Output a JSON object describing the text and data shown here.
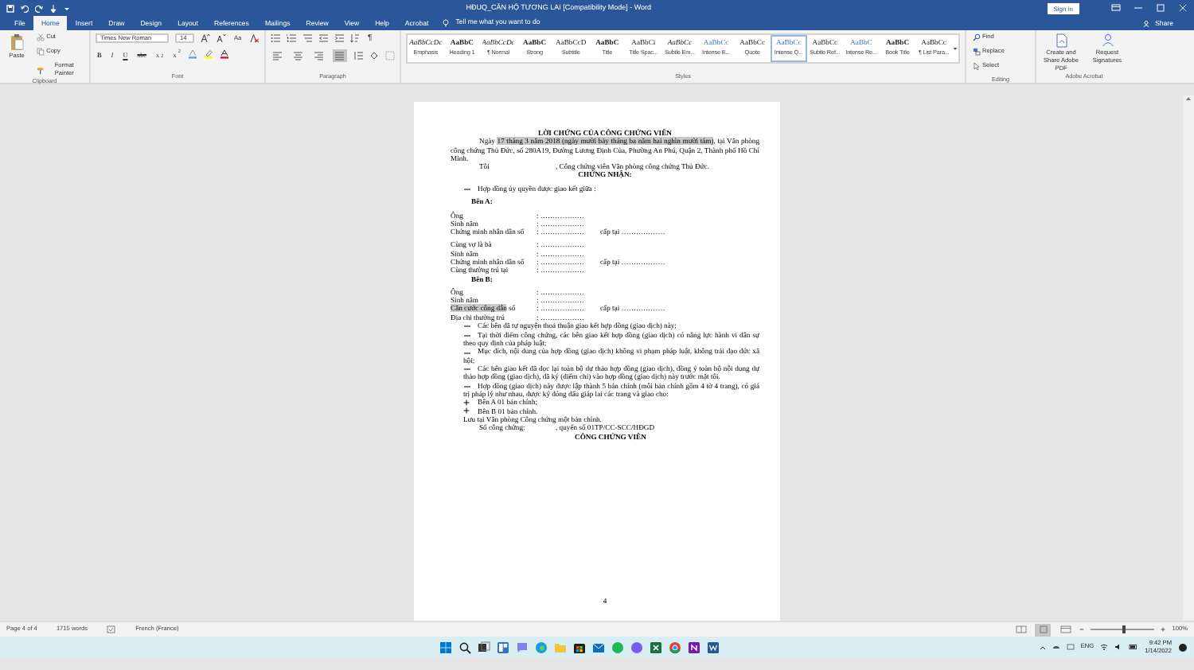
{
  "window": {
    "title": "HĐUQ_CĂN HỘ TƯƠNG LAI [Compatibility Mode] - Word",
    "sign_in": "Sign in"
  },
  "tabs": [
    {
      "label": "File",
      "selected": false
    },
    {
      "label": "Home",
      "selected": true
    },
    {
      "label": "Insert",
      "selected": false
    },
    {
      "label": "Draw",
      "selected": false
    },
    {
      "label": "Design",
      "selected": false
    },
    {
      "label": "Layout",
      "selected": false
    },
    {
      "label": "References",
      "selected": false
    },
    {
      "label": "Mailings",
      "selected": false
    },
    {
      "label": "Review",
      "selected": false
    },
    {
      "label": "View",
      "selected": false
    },
    {
      "label": "Help",
      "selected": false
    },
    {
      "label": "Acrobat",
      "selected": false
    }
  ],
  "tell_me": "Tell me what you want to do",
  "share": "Share",
  "clipboard": {
    "paste": "Paste",
    "cut": "Cut",
    "copy": "Copy",
    "format_painter": "Format Painter",
    "label": "Clipboard"
  },
  "font": {
    "name": "Times New Roman",
    "size": "14",
    "change_case": "Aa",
    "buttons": [
      "B",
      "I",
      "U",
      "abc",
      "x$_{2}$",
      "x$^{2}$"
    ],
    "label": "Font"
  },
  "paragraph": {
    "pilcrow": "¶",
    "alignments": [
      {
        "kind": "left",
        "selected": false
      },
      {
        "kind": "center",
        "selected": false
      },
      {
        "kind": "right",
        "selected": false
      },
      {
        "kind": "justify",
        "selected": true
      }
    ],
    "label": "Paragraph"
  },
  "styles": {
    "items": [
      {
        "sample": "AaBbCcDc",
        "name": "Emphasis",
        "kind": "italic",
        "selected": false
      },
      {
        "sample": "AaBbC",
        "name": "Heading 1",
        "kind": "bold",
        "selected": false
      },
      {
        "sample": "AaBbCcDc",
        "name": "¶ Normal",
        "kind": "italic",
        "selected": false
      },
      {
        "sample": "AaBbC",
        "name": "Strong",
        "kind": "bold",
        "selected": false
      },
      {
        "sample": "AaBbCcD",
        "name": "Subtitle",
        "kind": "plain",
        "selected": false
      },
      {
        "sample": "AaBbC",
        "name": "Title",
        "kind": "bold",
        "selected": false
      },
      {
        "sample": "AaBbCi",
        "name": "Title Spac...",
        "kind": "plain",
        "selected": false
      },
      {
        "sample": "AaBbCc",
        "name": "Subtle Em...",
        "kind": "italic",
        "selected": false
      },
      {
        "sample": "AaBbCc",
        "name": "Intense E...",
        "kind": "accent",
        "selected": false
      },
      {
        "sample": "AaBbCc",
        "name": "Quote",
        "kind": "plain",
        "selected": false
      },
      {
        "sample": "AaBbCc",
        "name": "Intense Q...",
        "kind": "accent",
        "selected": true
      },
      {
        "sample": "AaBbCc",
        "name": "Subtle Ref...",
        "kind": "plain",
        "selected": false
      },
      {
        "sample": "AaBbC",
        "name": "Intense Re...",
        "kind": "accent",
        "selected": false
      },
      {
        "sample": "AaBbC",
        "name": "Book Title",
        "kind": "bold",
        "selected": false
      },
      {
        "sample": "AaBbCc",
        "name": "¶ List Para...",
        "kind": "plain",
        "selected": false
      }
    ],
    "label": "Styles"
  },
  "editing": {
    "find": "Find",
    "replace": "Replace",
    "select": "Select",
    "label": "Editing"
  },
  "acrobat": {
    "create": "Create and Share Adobe PDF",
    "request": "Request Signatures",
    "label": "Adobe Acrobat"
  },
  "document": {
    "page_number": "4",
    "blocks": [
      {
        "kind": "title",
        "text": "LỜI CHỨNG CỦA CÔNG CHỨNG VIÊN"
      },
      {
        "kind": "para",
        "segments": [
          {
            "text": "Ngày ",
            "highlighted": false
          },
          {
            "text": "17 tháng 3 năm 2018 (ngày mười bảy tháng ba năm hai nghìn mười tám)",
            "highlighted": true
          },
          {
            "text": ", tại Văn phòng công chứng Thủ Đức, số 280A19, Đường Lương Định Của, Phường An Phú, Quận 2, Thành phố Hồ Chí Minh.",
            "highlighted": false
          }
        ]
      },
      {
        "kind": "fill",
        "before": "Tôi",
        "after": ", Công chứng viên Văn phòng công chứng Thủ Đức."
      },
      {
        "kind": "center",
        "text": "CHỨNG NHẬN:"
      },
      {
        "kind": "dash",
        "text": "Hợp đồng ủy quyền được giao kết giữa :",
        "space": true
      },
      {
        "kind": "party",
        "text": "Bên A:",
        "space": true
      },
      {
        "kind": "field",
        "label": "Ông",
        "value": ": ………………",
        "space": true
      },
      {
        "kind": "field",
        "label": "Sinh năm",
        "value": ": ………………"
      },
      {
        "kind": "field",
        "label": "Chứng minh nhân dân số",
        "value": ": ………………",
        "extra": "cấp tại ………………"
      },
      {
        "kind": "field",
        "label": "Cùng vợ là bà",
        "value": ": ………………",
        "space": true
      },
      {
        "kind": "field",
        "label": "Sinh năm",
        "value": ": ………………"
      },
      {
        "kind": "field",
        "label": "Chứng minh nhân dân số",
        "value": ": ………………",
        "extra": "cấp tại ………………"
      },
      {
        "kind": "field",
        "label": "Cùng thường trú tại",
        "value": ": ………………"
      },
      {
        "kind": "party",
        "text": "Bên B:"
      },
      {
        "kind": "field",
        "label": "Ông",
        "value": ": ………………",
        "space": true
      },
      {
        "kind": "field",
        "label": "Sinh năm",
        "value": ": ………………"
      },
      {
        "kind": "field",
        "label": [
          {
            "text": "Căn cước công dân",
            "highlighted": true
          },
          {
            "text": " số",
            "highlighted": false
          }
        ],
        "value": ": ………………",
        "extra": "cấp tại ………………"
      },
      {
        "kind": "field",
        "label": "Địa chỉ thường trú",
        "value": ": ………………"
      },
      {
        "kind": "dash",
        "text": "Các bên đã tự nguyện thoả thuận giao kết hợp đồng (giao dịch) này;"
      },
      {
        "kind": "dash",
        "text": "Tại thời điểm công chứng, các bên giao kết hợp đồng (giao dịch) có năng lực hành vi dân sự theo quy định của pháp luật;"
      },
      {
        "kind": "dash",
        "text": "Mục đích, nội dung của hợp đồng (giao dịch) không vi phạm pháp luật, không trái đạo đức xã hội;"
      },
      {
        "kind": "dash",
        "text": "Các bên giao kết đã đọc lại toàn bộ dự thảo hợp đồng (giao dịch), đồng ý toàn bộ nội dung dự thảo hợp đồng (giao dịch), đã ký (điểm chỉ) vào hợp đồng (giao dịch) này trước mặt tôi."
      },
      {
        "kind": "dash",
        "text": "Hợp đồng (giao dịch) này được lập thành 5 bản chính (mỗi bản chính gồm 4 tờ 4 trang), có giá trị pháp lý như nhau, được ký đóng dấu giáp lai các trang và giao cho:"
      },
      {
        "kind": "plus",
        "text": "Bên A 01 bản chính;"
      },
      {
        "kind": "plus",
        "text": "Bên B 01 bản chính."
      },
      {
        "kind": "plain",
        "text": "Lưu tại Văn phòng Công chứng một bản chính."
      },
      {
        "kind": "fill",
        "before": "Số công chứng:",
        "after": ", quyển số 01TP/CC-SCC/HĐGD"
      },
      {
        "kind": "signature",
        "text": "CÔNG CHỨNG VIÊN"
      }
    ]
  },
  "status_bar": {
    "page": "Page 4 of 4",
    "words": "1715 words",
    "language": "French (France)",
    "views": [
      {
        "kind": "read",
        "selected": false
      },
      {
        "kind": "print",
        "selected": true
      },
      {
        "kind": "web",
        "selected": false
      }
    ],
    "zoom": {
      "level": 0.5,
      "reading": "100%"
    }
  },
  "taskbar": {
    "apps": [
      {
        "kind": "start"
      },
      {
        "kind": "search"
      },
      {
        "kind": "taskview"
      },
      {
        "kind": "widgets"
      },
      {
        "kind": "chat"
      },
      {
        "kind": "edge"
      },
      {
        "kind": "folder"
      },
      {
        "kind": "store"
      },
      {
        "kind": "mail"
      },
      {
        "kind": "dot",
        "color": "#1db954"
      },
      {
        "kind": "dot",
        "color": "#7360f2"
      },
      {
        "kind": "excel"
      },
      {
        "kind": "chrome"
      },
      {
        "kind": "onenote"
      },
      {
        "kind": "word"
      }
    ],
    "language": "ENG",
    "time": "9:42 PM",
    "date": "1/14/2022"
  }
}
